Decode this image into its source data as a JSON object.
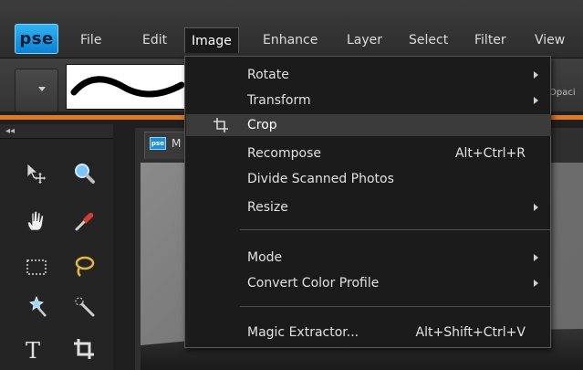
{
  "app": {
    "logo": "pse",
    "accent_color": "#e07a1f",
    "logo_color": "#1e9be6"
  },
  "menubar": {
    "items": [
      {
        "label": "File"
      },
      {
        "label": "Edit"
      },
      {
        "label": "Image",
        "active": true
      },
      {
        "label": "Enhance"
      },
      {
        "label": "Layer"
      },
      {
        "label": "Select"
      },
      {
        "label": "Filter"
      },
      {
        "label": "View"
      }
    ]
  },
  "options_bar": {
    "opacity_label": "Opaci"
  },
  "tool_panel": {
    "collapse_label": "◂◂",
    "tools": [
      {
        "icon": "move-tool-icon"
      },
      {
        "icon": "zoom-tool-icon"
      },
      {
        "icon": "hand-tool-icon"
      },
      {
        "icon": "eyedropper-tool-icon"
      },
      {
        "icon": "rectangular-marquee-tool-icon"
      },
      {
        "icon": "lasso-tool-icon"
      },
      {
        "icon": "magic-wand-tool-icon"
      },
      {
        "icon": "quick-selection-tool-icon"
      },
      {
        "icon": "type-tool-icon"
      },
      {
        "icon": "crop-tool-icon"
      }
    ]
  },
  "document": {
    "tab_icon": "pse",
    "tab_label": "M"
  },
  "image_menu": {
    "items": [
      {
        "label": "Rotate",
        "submenu": true
      },
      {
        "label": "Transform",
        "submenu": true
      },
      {
        "label": "Crop",
        "highlighted": true,
        "icon": "crop-icon"
      },
      {
        "label": "Recompose",
        "shortcut": "Alt+Ctrl+R"
      },
      {
        "label": "Divide Scanned Photos"
      },
      {
        "label": "Resize",
        "submenu": true
      },
      {
        "label": "Mode",
        "submenu": true
      },
      {
        "label": "Convert Color Profile",
        "submenu": true
      },
      {
        "label": "Magic Extractor...",
        "shortcut": "Alt+Shift+Ctrl+V"
      }
    ]
  }
}
